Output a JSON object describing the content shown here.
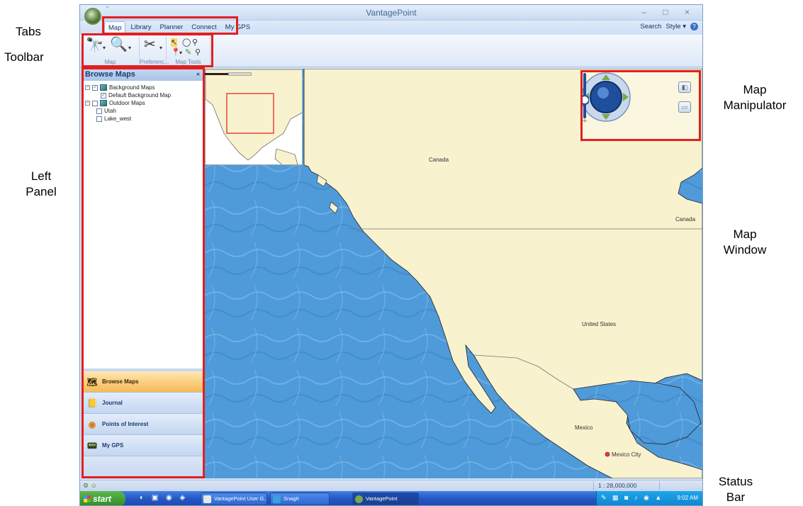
{
  "annotations": {
    "tabs": "Tabs",
    "toolbar": "Toolbar",
    "left_panel": "Left\nPanel",
    "map_manipulator": "Map\nManipulator",
    "map_window": "Map\nWindow",
    "status_bar": "Status\nBar"
  },
  "window": {
    "title": "VantagePoint",
    "controls": "– □ ×"
  },
  "tabs": [
    {
      "label": "Map",
      "active": true
    },
    {
      "label": "Library"
    },
    {
      "label": "Planner"
    },
    {
      "label": "Connect"
    },
    {
      "label": "My GPS"
    }
  ],
  "tabbar_right": {
    "search": "Search",
    "style": "Style ▾"
  },
  "ribbon": {
    "groups": [
      {
        "label": "Map"
      },
      {
        "label": "Preferenc..."
      },
      {
        "label": "Map Tools"
      }
    ]
  },
  "left_panel": {
    "title": "Browse Maps",
    "tree": [
      {
        "label": "Background Maps",
        "checked": true
      },
      {
        "label": "Default Background Map",
        "checked": true
      },
      {
        "label": "Outdoor Maps",
        "checked": false
      },
      {
        "label": "Utah",
        "checked": false
      },
      {
        "label": "Lake_west",
        "checked": false
      }
    ],
    "nav": [
      {
        "label": "Browse Maps",
        "icon": "map-icon",
        "active": true
      },
      {
        "label": "Journal",
        "icon": "journal-icon"
      },
      {
        "label": "Points of Interest",
        "icon": "poi-icon"
      },
      {
        "label": "My GPS",
        "icon": "gps-device-icon"
      }
    ]
  },
  "map": {
    "labels": {
      "canada": "Canada",
      "canada_east": "Canada",
      "us": "United States",
      "mexico": "Mexico",
      "mexico_city": "Mexico City"
    },
    "colors": {
      "water": "#4f9ad8",
      "land": "#f8f2cf"
    }
  },
  "status": {
    "scale": "1 : 28,000,000"
  },
  "taskbar": {
    "start": "start",
    "tasks": [
      {
        "label": "VantagePoint User G..."
      },
      {
        "label": "SnagIt"
      },
      {
        "label": "VantagePoint"
      }
    ],
    "clock": "9:02 AM"
  }
}
